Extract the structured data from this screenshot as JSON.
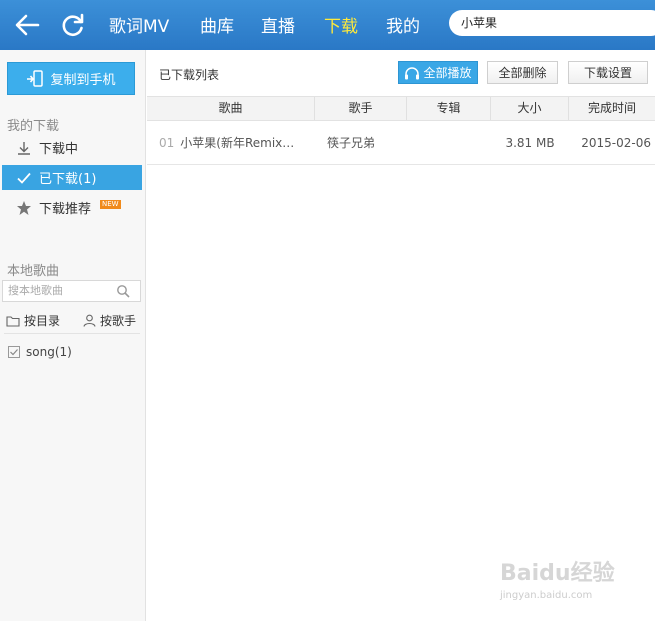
{
  "nav": {
    "items": [
      {
        "label": "歌词MV"
      },
      {
        "label": "曲库"
      },
      {
        "label": "直播"
      },
      {
        "label": "下载",
        "active": true
      },
      {
        "label": "我的"
      }
    ],
    "search_value": "小苹果",
    "active_color": "#ffea3a"
  },
  "sidebar": {
    "copy_to_phone": "复制到手机",
    "my_downloads_title": "我的下载",
    "items": [
      {
        "label": "下载中",
        "icon": "download-arrow-icon"
      },
      {
        "label": "已下载(1)",
        "icon": "check-icon",
        "active": true
      },
      {
        "label": "下载推荐",
        "icon": "star-icon",
        "badge": "NEW"
      }
    ],
    "local_title": "本地歌曲",
    "local_search_placeholder": "搜本地歌曲",
    "filter_by_dir": "按目录",
    "filter_by_artist": "按歌手",
    "folder_label": "song(1)"
  },
  "main": {
    "list_title": "已下载列表",
    "play_all": "全部播放",
    "delete_all": "全部删除",
    "download_settings": "下载设置",
    "columns": [
      "歌曲",
      "歌手",
      "专辑",
      "大小",
      "完成时间"
    ],
    "rows": [
      {
        "num": "01",
        "song": "小苹果(新年Remix…",
        "artist": "筷子兄弟",
        "album": "",
        "size": "3.81 MB",
        "time": "2015-02-06"
      }
    ]
  },
  "watermark": {
    "brand": "Baidu经验",
    "url": "jingyan.baidu.com"
  },
  "colors": {
    "topbar": "#3084d0",
    "accent": "#3aa7e6",
    "badge": "#f08a1b"
  }
}
